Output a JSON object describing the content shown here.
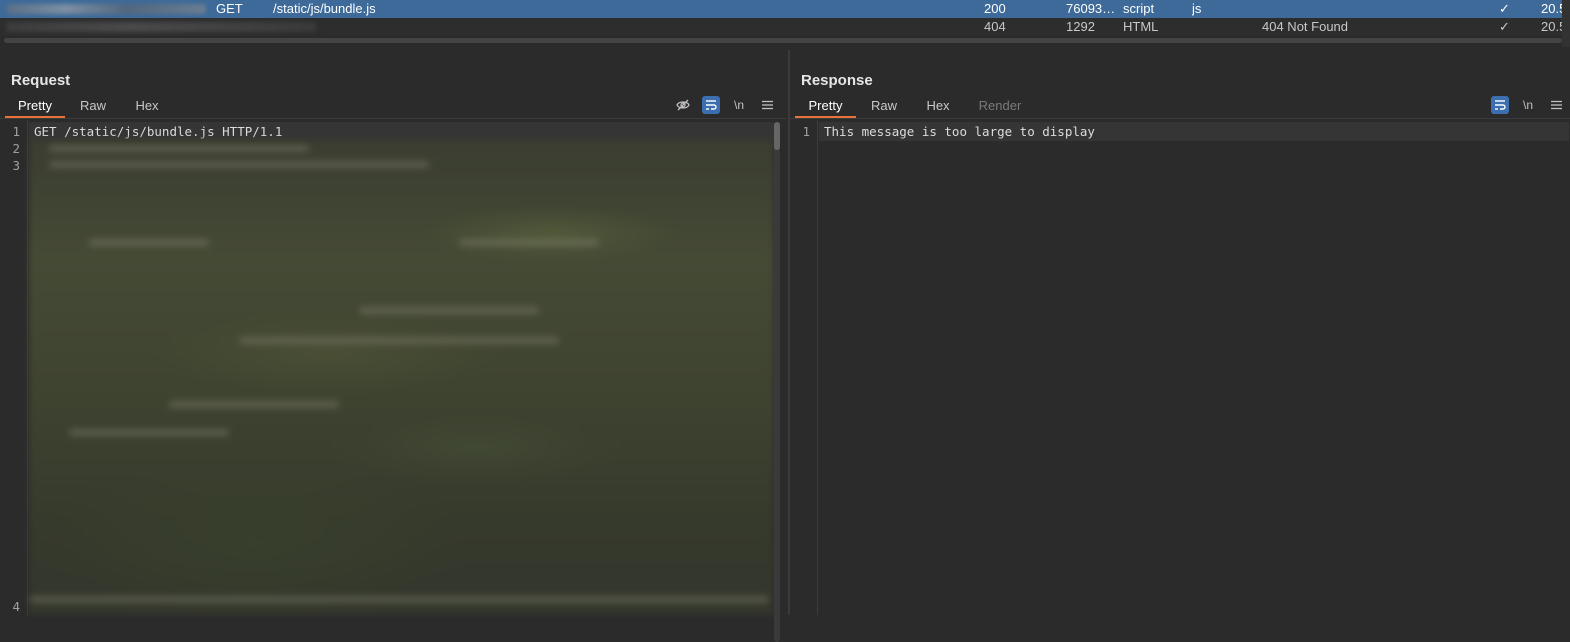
{
  "history": {
    "rows": [
      {
        "selected": true,
        "method": "GET",
        "url": "/static/js/bundle.js",
        "status": "200",
        "length": "76093…",
        "mime": "script",
        "extension": "js",
        "title": "",
        "check": "✓",
        "time": "20.5"
      },
      {
        "selected": false,
        "method": "",
        "url": "",
        "status": "404",
        "length": "1292",
        "mime": "HTML",
        "extension": "",
        "title": "404 Not Found",
        "check": "✓",
        "time": "20.5"
      }
    ]
  },
  "layout_buttons": [
    "side-by-side",
    "stacked",
    "single"
  ],
  "request": {
    "title": "Request",
    "tabs": [
      {
        "label": "Pretty",
        "active": true
      },
      {
        "label": "Raw",
        "active": false
      },
      {
        "label": "Hex",
        "active": false
      }
    ],
    "tools": {
      "hide_icon": "eye-off-icon",
      "wrap_icon": "word-wrap-icon",
      "newline_label": "\\n",
      "menu_icon": "hamburger-menu-icon"
    },
    "line_numbers": [
      "1",
      "2",
      "3",
      "4"
    ],
    "first_line": "GET /static/js/bundle.js HTTP/1.1"
  },
  "response": {
    "title": "Response",
    "tabs": [
      {
        "label": "Pretty",
        "active": true
      },
      {
        "label": "Raw",
        "active": false
      },
      {
        "label": "Hex",
        "active": false
      },
      {
        "label": "Render",
        "active": false,
        "disabled": true
      }
    ],
    "tools": {
      "wrap_icon": "word-wrap-icon",
      "newline_label": "\\n",
      "menu_icon": "hamburger-menu-icon"
    },
    "line_numbers": [
      "1"
    ],
    "message": "This message is too large to display"
  },
  "colors": {
    "selected_row": "#3d6a99",
    "accent_tab": "#e8743b",
    "active_tool": "#3b6fb0"
  }
}
